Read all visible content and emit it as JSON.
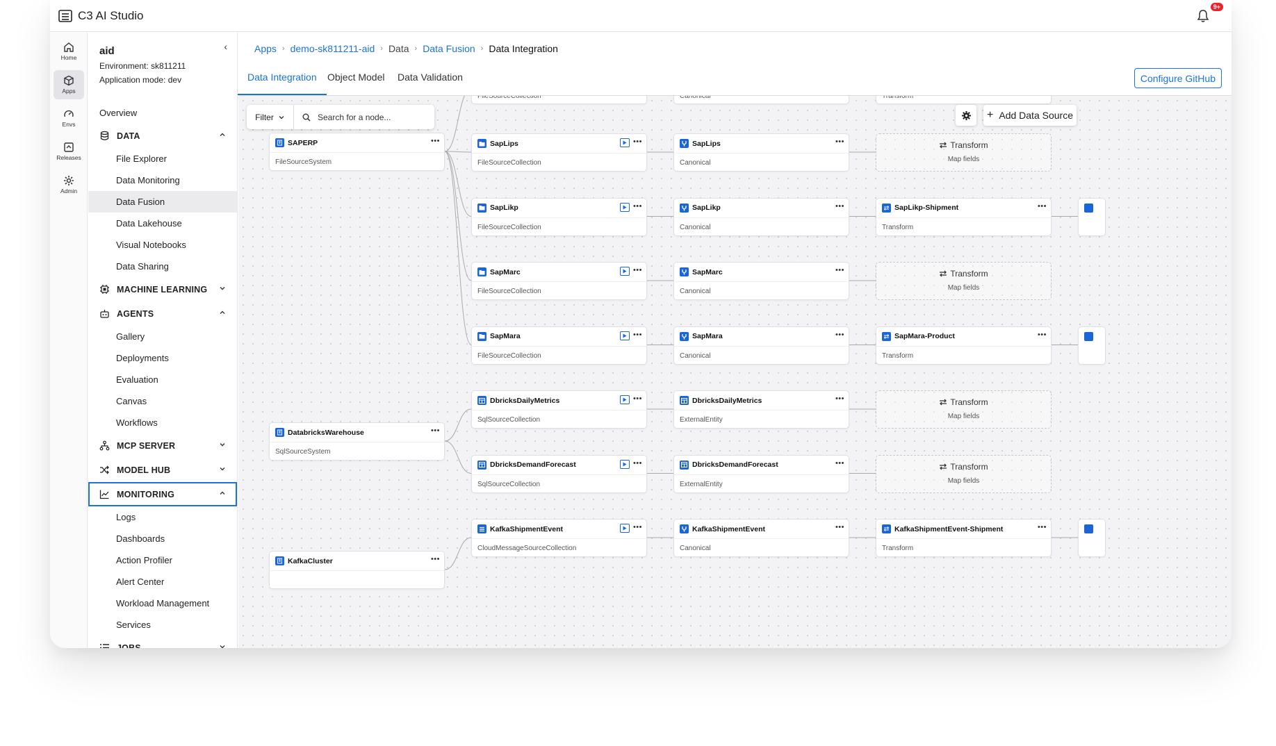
{
  "app": {
    "title": "C3 AI Studio",
    "notification_badge": "9+"
  },
  "rail": [
    {
      "label": "Home",
      "icon": "home-icon"
    },
    {
      "label": "Apps",
      "icon": "cube-icon"
    },
    {
      "label": "Envs",
      "icon": "gauge-icon"
    },
    {
      "label": "Releases",
      "icon": "releases-icon"
    },
    {
      "label": "Admin",
      "icon": "gear-icon"
    }
  ],
  "sidebar": {
    "app_name": "aid",
    "environment": "Environment: sk811211",
    "mode": "Application mode: dev",
    "items": [
      {
        "label": "Overview",
        "kind": "top"
      },
      {
        "label": "DATA",
        "kind": "section",
        "icon": "database-icon",
        "chevron": "up"
      },
      {
        "label": "File Explorer",
        "kind": "child"
      },
      {
        "label": "Data Monitoring",
        "kind": "child"
      },
      {
        "label": "Data Fusion",
        "kind": "child",
        "selected": true
      },
      {
        "label": "Data Lakehouse",
        "kind": "child"
      },
      {
        "label": "Visual Notebooks",
        "kind": "child"
      },
      {
        "label": "Data Sharing",
        "kind": "child"
      },
      {
        "label": "MACHINE LEARNING",
        "kind": "section",
        "icon": "chip-icon",
        "chevron": "down"
      },
      {
        "label": "AGENTS",
        "kind": "section",
        "icon": "robot-icon",
        "chevron": "up"
      },
      {
        "label": "Gallery",
        "kind": "child"
      },
      {
        "label": "Deployments",
        "kind": "child"
      },
      {
        "label": "Evaluation",
        "kind": "child"
      },
      {
        "label": "Canvas",
        "kind": "child"
      },
      {
        "label": "Workflows",
        "kind": "child"
      },
      {
        "label": "MCP SERVER",
        "kind": "section",
        "icon": "network-icon",
        "chevron": "down"
      },
      {
        "label": "MODEL HUB",
        "kind": "section",
        "icon": "shuffle-icon",
        "chevron": "down"
      },
      {
        "label": "MONITORING",
        "kind": "section",
        "icon": "chart-line-icon",
        "chevron": "up",
        "outlined": true
      },
      {
        "label": "Logs",
        "kind": "child"
      },
      {
        "label": "Dashboards",
        "kind": "child"
      },
      {
        "label": "Action Profiler",
        "kind": "child"
      },
      {
        "label": "Alert Center",
        "kind": "child"
      },
      {
        "label": "Workload Management",
        "kind": "child"
      },
      {
        "label": "Services",
        "kind": "child"
      },
      {
        "label": "JOBS",
        "kind": "section",
        "icon": "list-icon",
        "chevron": "down"
      }
    ]
  },
  "breadcrumb": [
    {
      "label": "Apps",
      "link": true
    },
    {
      "label": "demo-sk811211-aid",
      "link": true
    },
    {
      "label": "Data",
      "link": false
    },
    {
      "label": "Data Fusion",
      "link": true
    },
    {
      "label": "Data Integration",
      "link": false,
      "current": true
    }
  ],
  "tabs": [
    {
      "label": "Data Integration",
      "active": true
    },
    {
      "label": "Object Model"
    },
    {
      "label": "Data Validation"
    }
  ],
  "configure_github": "Configure GitHub",
  "toolbar": {
    "filter": "Filter",
    "search_placeholder": "Search for a node...",
    "add_data_source": "Add Data Source"
  },
  "partial_top": [
    "FileSourceCollection",
    "Canonical",
    "Transform"
  ],
  "sources": [
    {
      "name": "SAPERP",
      "type": "FileSourceSystem"
    },
    {
      "name": "DatabricksWarehouse",
      "type": "SqlSourceSystem"
    },
    {
      "name": "KafkaCluster",
      "type": ""
    }
  ],
  "rows": [
    {
      "collection": {
        "name": "SapLips",
        "type": "FileSourceCollection",
        "icon": "folder"
      },
      "entity": {
        "name": "SapLips",
        "type": "Canonical",
        "icon": "canonical"
      },
      "transform": {
        "kind": "empty",
        "title": "Transform",
        "sub": "Map fields"
      }
    },
    {
      "collection": {
        "name": "SapLikp",
        "type": "FileSourceCollection",
        "icon": "folder"
      },
      "entity": {
        "name": "SapLikp",
        "type": "Canonical",
        "icon": "canonical"
      },
      "transform": {
        "kind": "node",
        "title": "SapLikp-Shipment",
        "sub": "Transform"
      }
    },
    {
      "collection": {
        "name": "SapMarc",
        "type": "FileSourceCollection",
        "icon": "folder"
      },
      "entity": {
        "name": "SapMarc",
        "type": "Canonical",
        "icon": "canonical"
      },
      "transform": {
        "kind": "empty",
        "title": "Transform",
        "sub": "Map fields"
      }
    },
    {
      "collection": {
        "name": "SapMara",
        "type": "FileSourceCollection",
        "icon": "folder"
      },
      "entity": {
        "name": "SapMara",
        "type": "Canonical",
        "icon": "canonical"
      },
      "transform": {
        "kind": "node",
        "title": "SapMara-Product",
        "sub": "Transform"
      }
    },
    {
      "collection": {
        "name": "DbricksDailyMetrics",
        "type": "SqlSourceCollection",
        "icon": "table"
      },
      "entity": {
        "name": "DbricksDailyMetrics",
        "type": "ExternalEntity",
        "icon": "table"
      },
      "transform": {
        "kind": "empty",
        "title": "Transform",
        "sub": "Map fields"
      }
    },
    {
      "collection": {
        "name": "DbricksDemandForecast",
        "type": "SqlSourceCollection",
        "icon": "table"
      },
      "entity": {
        "name": "DbricksDemandForecast",
        "type": "ExternalEntity",
        "icon": "table"
      },
      "transform": {
        "kind": "empty",
        "title": "Transform",
        "sub": "Map fields"
      }
    },
    {
      "collection": {
        "name": "KafkaShipmentEvent",
        "type": "CloudMessageSourceCollection",
        "icon": "list"
      },
      "entity": {
        "name": "KafkaShipmentEvent",
        "type": "Canonical",
        "icon": "canonical"
      },
      "transform": {
        "kind": "node",
        "title": "KafkaShipmentEvent-Shipment",
        "sub": "Transform"
      }
    }
  ]
}
